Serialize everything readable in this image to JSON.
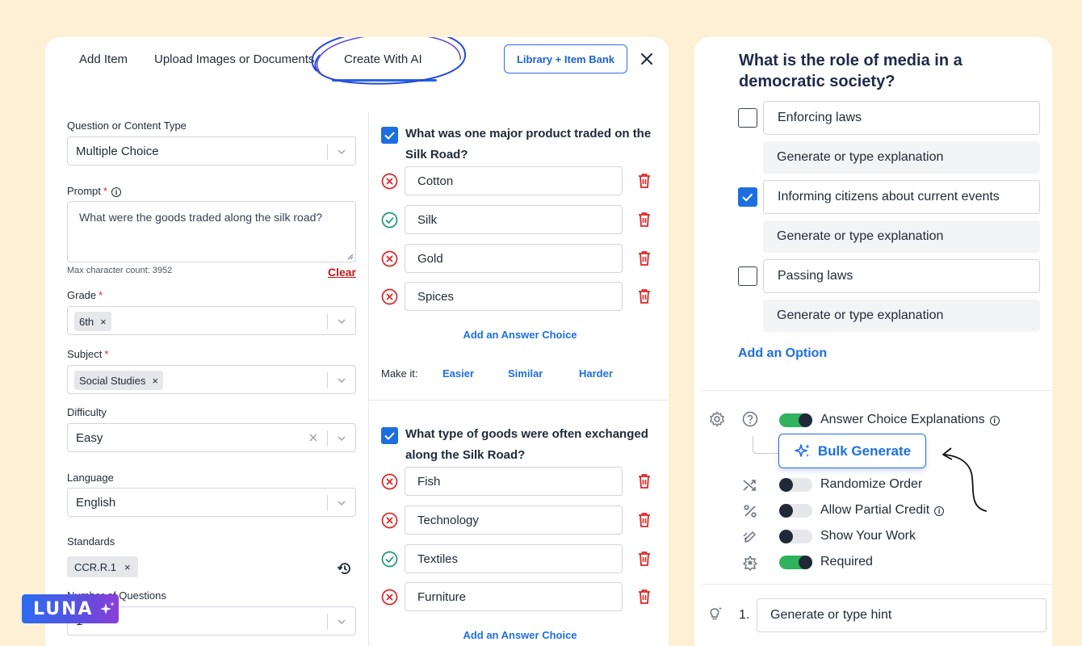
{
  "tabs": [
    {
      "label": "Add Item"
    },
    {
      "label": "Upload Images or Documents"
    },
    {
      "label": "Create With AI",
      "active": true
    }
  ],
  "library_button": "Library + Item Bank",
  "form": {
    "type_label": "Question or Content Type",
    "type_value": "Multiple Choice",
    "prompt_label": "Prompt",
    "required_mark": "*",
    "prompt_value": "What were the goods traded along the silk road?",
    "max_chars": "Max character count: 3952",
    "clear": "Clear",
    "grade_label": "Grade",
    "grade_chip": "6th",
    "subject_label": "Subject",
    "subject_chip": "Social Studies",
    "difficulty_label": "Difficulty",
    "difficulty_value": "Easy",
    "language_label": "Language",
    "language_value": "English",
    "standards_label": "Standards",
    "standards_chip": "CCR.R.1",
    "num_questions_label": "Number of Questions",
    "num_questions_value": "1",
    "chip_remove": "×"
  },
  "questions": [
    {
      "title": "What was one major product traded on the Silk Road?",
      "answers": [
        {
          "text": "Cotton",
          "correct": false
        },
        {
          "text": "Silk",
          "correct": true
        },
        {
          "text": "Gold",
          "correct": false
        },
        {
          "text": "Spices",
          "correct": false
        }
      ],
      "add_choice": "Add an Answer Choice",
      "make_it": "Make it:",
      "easier": "Easier",
      "similar": "Similar",
      "harder": "Harder"
    },
    {
      "title": "What type of goods were often exchanged along the Silk Road?",
      "answers": [
        {
          "text": "Fish",
          "correct": false
        },
        {
          "text": "Technology",
          "correct": false
        },
        {
          "text": "Textiles",
          "correct": true
        },
        {
          "text": "Furniture",
          "correct": false
        }
      ],
      "add_choice": "Add an Answer Choice"
    }
  ],
  "right": {
    "question": "What is the role of media in a democratic society?",
    "options": [
      {
        "text": "Enforcing laws",
        "checked": false,
        "explanation": "Generate or type explanation"
      },
      {
        "text": "Informing citizens about current events",
        "checked": true,
        "explanation": "Generate or type explanation"
      },
      {
        "text": "Passing laws",
        "checked": false,
        "explanation": "Generate or type explanation"
      }
    ],
    "add_option": "Add an Option",
    "settings": {
      "answer_explanations": {
        "label": "Answer Choice Explanations",
        "on": true
      },
      "bulk_generate": "Bulk Generate",
      "randomize": {
        "label": "Randomize Order",
        "on": false
      },
      "partial_credit": {
        "label": "Allow Partial Credit",
        "on": false
      },
      "show_work": {
        "label": "Show Your Work",
        "on": false
      },
      "required": {
        "label": "Required",
        "on": true
      }
    },
    "hint_number": "1.",
    "hint_placeholder": "Generate or type hint"
  },
  "badge": "LUNA",
  "colors": {
    "accent": "#1d6fe0",
    "correct": "#1a9b74",
    "wrong": "#dc2626",
    "toggle_on": "#2fb35d"
  }
}
